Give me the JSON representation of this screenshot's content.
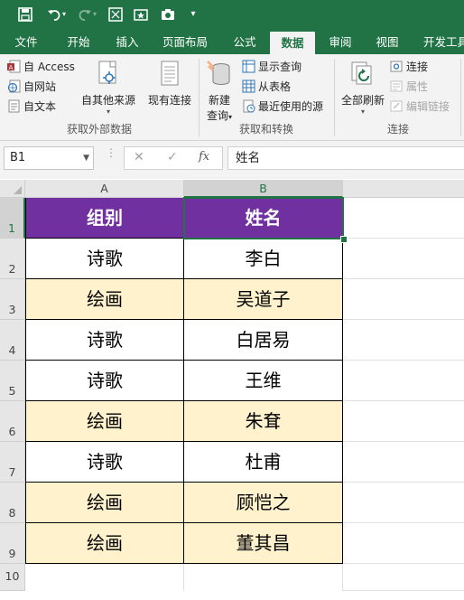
{
  "colors": {
    "accent": "#217346",
    "header_fill": "#7030a0",
    "header_text": "#ffffff",
    "alt_row_fill": "#fff2cc",
    "row_fill": "#ffffff"
  },
  "quick_access": {
    "icons": [
      "save-icon",
      "undo-icon",
      "undo-dropdown-icon",
      "redo-icon",
      "redo-dropdown-icon",
      "custom-icon-1",
      "custom-icon-2",
      "camera-icon",
      "customize-qat-icon"
    ]
  },
  "tabs": [
    {
      "label": "文件"
    },
    {
      "label": "开始"
    },
    {
      "label": "插入"
    },
    {
      "label": "页面布局"
    },
    {
      "label": "公式"
    },
    {
      "label": "数据",
      "active": true
    },
    {
      "label": "审阅"
    },
    {
      "label": "视图"
    },
    {
      "label": "开发工具"
    }
  ],
  "ribbon": {
    "external": {
      "group_label": "获取外部数据",
      "access": "自 Access",
      "web": "自网站",
      "text": "自文本",
      "other": "自其他来源",
      "existing": "现有连接"
    },
    "transform": {
      "group_label": "获取和转换",
      "new_query_1": "新建",
      "new_query_2": "查询",
      "show_queries": "显示查询",
      "from_table": "从表格",
      "recent_sources": "最近使用的源"
    },
    "connections": {
      "group_label": "连接",
      "refresh_all": "全部刷新",
      "connections": "连接",
      "properties": "属性",
      "edit_links": "编辑链接"
    }
  },
  "formula_bar": {
    "name_box": "B1",
    "fx_label": "fx",
    "content": "姓名"
  },
  "sheet": {
    "columns": [
      "A",
      "B"
    ],
    "rows": [
      "1",
      "2",
      "3",
      "4",
      "5",
      "6",
      "7",
      "8",
      "9",
      "10"
    ],
    "header": {
      "group": "组别",
      "name": "姓名"
    },
    "data": [
      {
        "group": "诗歌",
        "name": "李白"
      },
      {
        "group": "绘画",
        "name": "吴道子"
      },
      {
        "group": "诗歌",
        "name": "白居易"
      },
      {
        "group": "诗歌",
        "name": "王维"
      },
      {
        "group": "绘画",
        "name": "朱耷"
      },
      {
        "group": "诗歌",
        "name": "杜甫"
      },
      {
        "group": "绘画",
        "name": "顾恺之"
      },
      {
        "group": "绘画",
        "name": "董其昌"
      }
    ],
    "selected_cell": "B1"
  }
}
